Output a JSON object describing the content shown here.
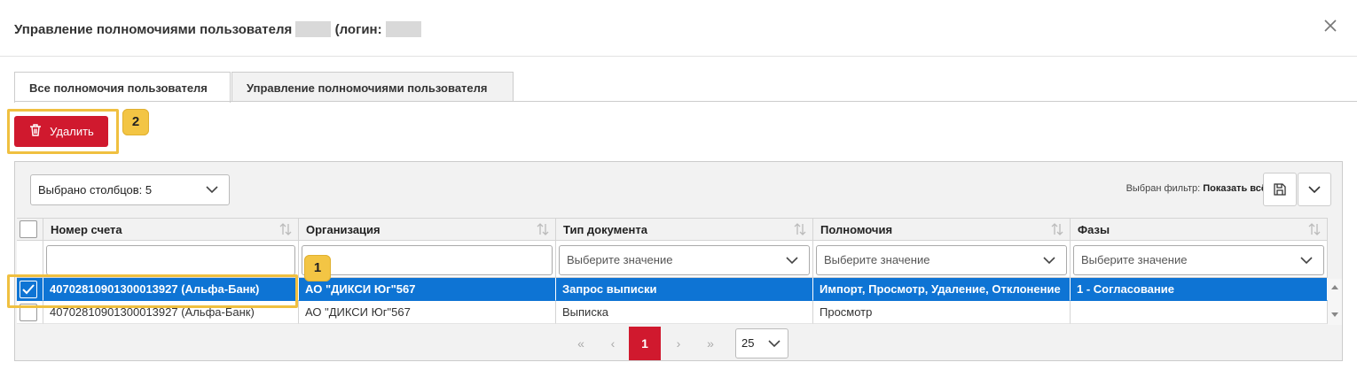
{
  "modal": {
    "title": "Управление полномочиями пользователя",
    "login_prefix": "(логин:"
  },
  "tabs": [
    {
      "label": "Все полномочия пользователя"
    },
    {
      "label": "Управление полномочиями пользователя"
    }
  ],
  "delete_button": {
    "label": "Удалить"
  },
  "badges": {
    "first": "1",
    "second": "2"
  },
  "grid": {
    "columns_select": "Выбрано столбцов: 5",
    "filter_label": "Выбран фильтр:",
    "filter_value": "Показать всё",
    "headers": [
      "Номер счета",
      "Организация",
      "Тип документа",
      "Полномочия",
      "Фазы"
    ],
    "filter_placeholder": "Выберите значение",
    "rows": [
      {
        "account": "40702810901300013927 (Альфа-Банк)",
        "org": "АО \"ДИКСИ Юг\"567",
        "doc_type": "Запрос выписки",
        "rights": "Импорт, Просмотр, Удаление, Отклонение",
        "phase": "1 - Согласование",
        "selected": true
      },
      {
        "account": "40702810901300013927 (Альфа-Банк)",
        "org": "АО \"ДИКСИ Юг\"567",
        "doc_type": "Выписка",
        "rights": "Просмотр",
        "phase": "",
        "selected": false
      }
    ]
  },
  "pager": {
    "first": "«",
    "prev": "‹",
    "current": "1",
    "next": "›",
    "last": "»",
    "page_size": "25"
  },
  "colors": {
    "danger": "#d0192e",
    "selected_row": "#0e74d4",
    "badge": "#f3c544"
  }
}
